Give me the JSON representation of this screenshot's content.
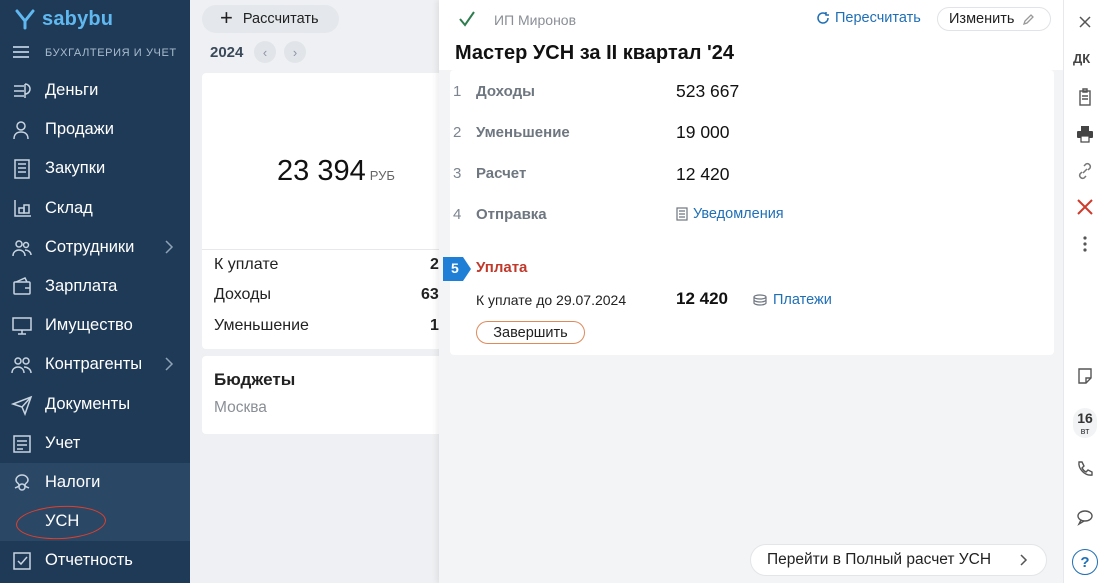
{
  "app": {
    "logo_text": "sabybu",
    "subtitle": "БУХГАЛТЕРИЯ И УЧЕТ",
    "brand_color": "#5fb8f0",
    "sidebar_color": "#1f3a56"
  },
  "sidebar": {
    "items": [
      {
        "label": "Деньги",
        "icon": "money-icon"
      },
      {
        "label": "Продажи",
        "icon": "sales-icon"
      },
      {
        "label": "Закупки",
        "icon": "purchases-icon"
      },
      {
        "label": "Склад",
        "icon": "warehouse-icon"
      },
      {
        "label": "Сотрудники",
        "icon": "employees-icon",
        "has_submenu": true
      },
      {
        "label": "Зарплата",
        "icon": "salary-icon"
      },
      {
        "label": "Имущество",
        "icon": "property-icon"
      },
      {
        "label": "Контрагенты",
        "icon": "counterparties-icon",
        "has_submenu": true
      },
      {
        "label": "Документы",
        "icon": "documents-icon"
      },
      {
        "label": "Учет",
        "icon": "accounting-icon"
      },
      {
        "label": "Налоги",
        "icon": "taxes-icon",
        "active": true
      },
      {
        "label": "Отчетность",
        "icon": "reporting-icon"
      }
    ],
    "sub_item": {
      "label": "УСН",
      "annotated": true
    }
  },
  "middle": {
    "calc_button": "Рассчитать",
    "year": "2024",
    "total_amount": "23 394",
    "currency": "РУБ",
    "rows": [
      {
        "label": "К уплате",
        "value": "2"
      },
      {
        "label": "Доходы",
        "value": "63"
      },
      {
        "label": "Уменьшение",
        "value": "1"
      }
    ],
    "budgets_title": "Бюджеты",
    "budgets_region": "Москва"
  },
  "panel": {
    "org_name": "ИП Миронов",
    "recalc_label": "Пересчитать",
    "edit_label": "Изменить",
    "title": "Мастер УСН за II квартал '24",
    "steps": [
      {
        "num": "1",
        "label": "Доходы",
        "value": "523 667"
      },
      {
        "num": "2",
        "label": "Уменьшение",
        "value": "19 000"
      },
      {
        "num": "3",
        "label": "Расчет",
        "value": "12 420"
      },
      {
        "num": "4",
        "label": "Отправка",
        "link": "Уведомления"
      }
    ],
    "active_step": {
      "num": "5",
      "label": "Уплата",
      "due_label": "К уплате до 29.07.2024",
      "due_value": "12 420",
      "payments_link": "Платежи",
      "finish_button": "Завершить"
    },
    "full_calc_button": "Перейти в Полный расчет УСН",
    "accent_color": "#1f6fb6",
    "active_step_color": "#c0392b"
  },
  "toolbar": {
    "dk_label": "ДК",
    "calendar_day": "16",
    "calendar_weekday": "вт",
    "help_label": "?"
  }
}
